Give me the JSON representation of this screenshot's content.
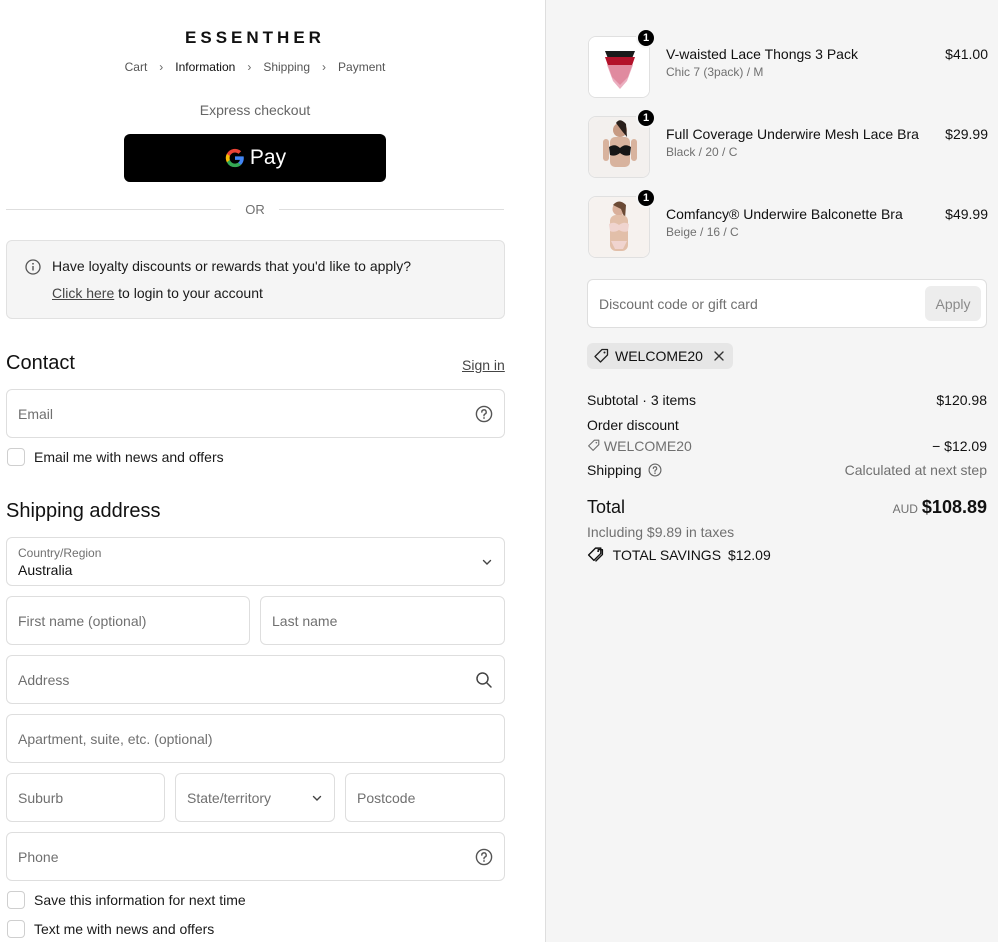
{
  "brand": "ESSENTHER",
  "breadcrumb": [
    "Cart",
    "Information",
    "Shipping",
    "Payment"
  ],
  "breadcrumb_active": 1,
  "express_label": "Express checkout",
  "gpay_label": "Pay",
  "or_label": "OR",
  "loyalty": {
    "question": "Have loyalty discounts or rewards that you'd like to apply?",
    "link": "Click here",
    "link_suffix": " to login to your account"
  },
  "contact": {
    "title": "Contact",
    "signin": "Sign in",
    "email_placeholder": "Email",
    "news_label": "Email me with news and offers"
  },
  "shipping": {
    "title": "Shipping address",
    "country_label": "Country/Region",
    "country_value": "Australia",
    "first_name": "First name (optional)",
    "last_name": "Last name",
    "address": "Address",
    "apartment": "Apartment, suite, etc. (optional)",
    "suburb": "Suburb",
    "state": "State/territory",
    "postcode": "Postcode",
    "phone": "Phone",
    "save_label": "Save this information for next time",
    "text_label": "Text me with news and offers"
  },
  "cart": {
    "items": [
      {
        "name": "V-waisted Lace Thongs 3 Pack",
        "variant": "Chic 7 (3pack) / M",
        "price": "$41.00",
        "qty": "1"
      },
      {
        "name": "Full Coverage Underwire Mesh Lace Bra",
        "variant": "Black / 20 / C",
        "price": "$29.99",
        "qty": "1"
      },
      {
        "name": "Comfancy® Underwire Balconette Bra",
        "variant": "Beige / 16 / C",
        "price": "$49.99",
        "qty": "1"
      }
    ],
    "discount_placeholder": "Discount code or gift card",
    "apply_label": "Apply",
    "code": "WELCOME20",
    "subtotal_label": "Subtotal",
    "subtotal_items": "· 3 items",
    "subtotal_value": "$120.98",
    "order_discount_label": "Order discount",
    "discount_code": "WELCOME20",
    "discount_value": "− $12.09",
    "shipping_label": "Shipping",
    "shipping_value": "Calculated at next step",
    "total_label": "Total",
    "currency": "AUD",
    "total_value": "$108.89",
    "taxes": "Including $9.89 in taxes",
    "savings_label": "TOTAL SAVINGS",
    "savings_value": "$12.09"
  }
}
